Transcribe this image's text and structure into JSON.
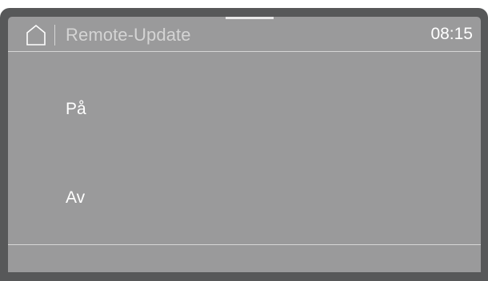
{
  "header": {
    "home_icon": "home-icon",
    "title": "Remote-Update",
    "time": "08:15"
  },
  "options": [
    {
      "label": "På"
    },
    {
      "label": "Av"
    }
  ],
  "colors": {
    "bezel": "#575859",
    "screen": "#9a9a9b",
    "text": "#ffffff",
    "title_text": "#d4d4d4",
    "divider": "#d6d6d6"
  }
}
